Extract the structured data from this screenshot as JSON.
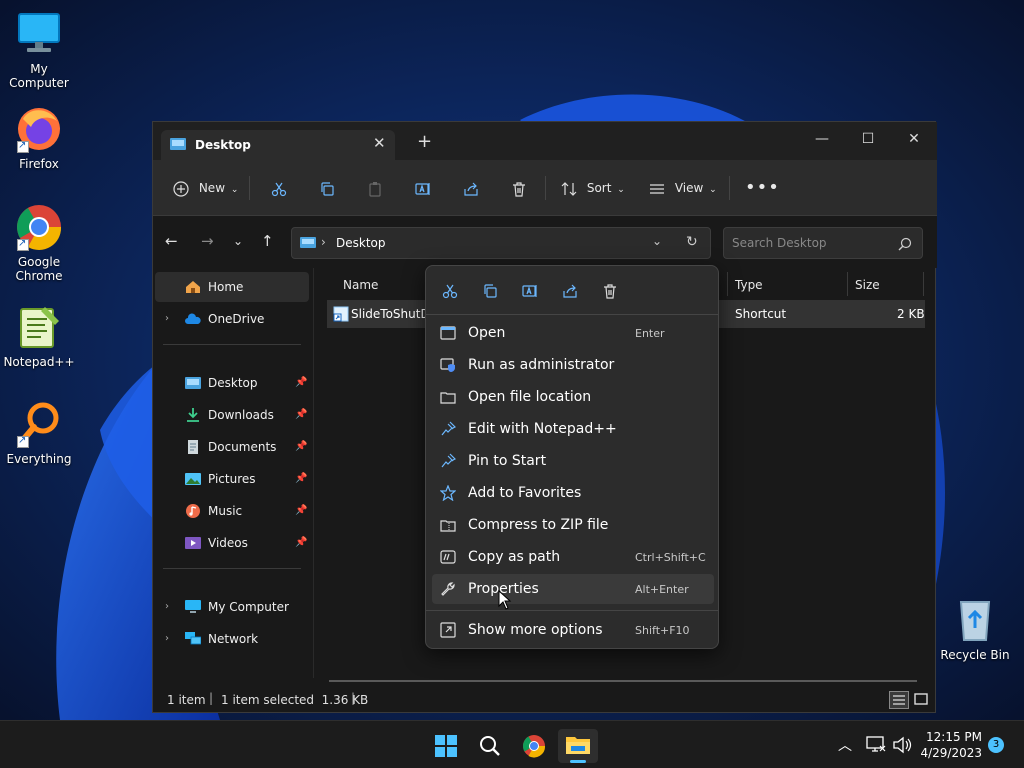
{
  "desktop_icons": [
    {
      "label": "My Computer"
    },
    {
      "label": "Firefox"
    },
    {
      "label": "Google Chrome"
    },
    {
      "label": "Notepad++"
    },
    {
      "label": "Everything"
    },
    {
      "label": "Recycle Bin"
    }
  ],
  "window": {
    "tab_title": "Desktop",
    "toolbar": {
      "new_label": "New",
      "sort_label": "Sort",
      "view_label": "View"
    },
    "address": "Desktop",
    "search_placeholder": "Search Desktop"
  },
  "nav_pane": {
    "home": "Home",
    "onedrive": "OneDrive",
    "quick_access": [
      "Desktop",
      "Downloads",
      "Documents",
      "Pictures",
      "Music",
      "Videos"
    ],
    "my_computer": "My Computer",
    "network": "Network"
  },
  "columns": {
    "name": "Name",
    "type": "Type",
    "size": "Size"
  },
  "file": {
    "name": "SlideToShutDo",
    "type": "Shortcut",
    "size": "2 KB"
  },
  "status": {
    "count": "1 item",
    "selected": "1 item selected  1.36 KB"
  },
  "context_menu": {
    "items": [
      {
        "label": "Open",
        "shortcut": "Enter"
      },
      {
        "label": "Run as administrator",
        "shortcut": ""
      },
      {
        "label": "Open file location",
        "shortcut": ""
      },
      {
        "label": "Edit with Notepad++",
        "shortcut": ""
      },
      {
        "label": "Pin to Start",
        "shortcut": ""
      },
      {
        "label": "Add to Favorites",
        "shortcut": ""
      },
      {
        "label": "Compress to ZIP file",
        "shortcut": ""
      },
      {
        "label": "Copy as path",
        "shortcut": "Ctrl+Shift+C"
      },
      {
        "label": "Properties",
        "shortcut": "Alt+Enter"
      }
    ],
    "more": {
      "label": "Show more options",
      "shortcut": "Shift+F10"
    }
  },
  "taskbar": {
    "time": "12:15 PM",
    "date": "4/29/2023",
    "notification_count": "3"
  },
  "colors": {
    "accent": "#4cc2ff",
    "menu_bg": "#2c2c2c",
    "window_bg": "#191919"
  }
}
